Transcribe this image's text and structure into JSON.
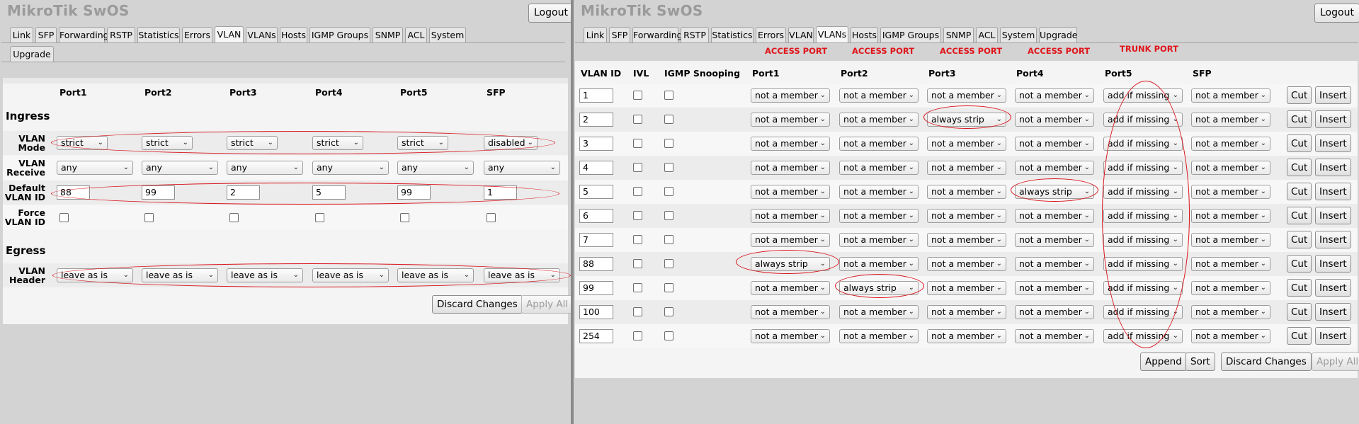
{
  "app": {
    "brand": "MikroTik SwOS",
    "logout_label": "Logout"
  },
  "left": {
    "tabs_row1": [
      "Link",
      "SFP",
      "Forwarding",
      "RSTP",
      "Statistics",
      "Errors",
      "VLAN",
      "VLANs",
      "Hosts",
      "IGMP Groups",
      "SNMP",
      "ACL",
      "System"
    ],
    "tabs_row2": [
      "Upgrade"
    ],
    "active_tab": "VLAN",
    "columns": [
      "Port1",
      "Port2",
      "Port3",
      "Port4",
      "Port5",
      "SFP"
    ],
    "ingress_title": "Ingress",
    "egress_title": "Egress",
    "labels": {
      "vlan_mode": [
        "VLAN",
        "Mode"
      ],
      "vlan_receive": [
        "VLAN",
        "Receive"
      ],
      "default_vlan_id": [
        "Default",
        "VLAN ID"
      ],
      "force_vlan_id": [
        "Force",
        "VLAN ID"
      ],
      "vlan_header": [
        "VLAN",
        "Header"
      ]
    },
    "vlan_mode": [
      "strict",
      "strict",
      "strict",
      "strict",
      "strict",
      "disabled"
    ],
    "vlan_receive": [
      "any",
      "any",
      "any",
      "any",
      "any",
      "any"
    ],
    "default_vlan_id": [
      "88",
      "99",
      "2",
      "5",
      "99",
      "1"
    ],
    "force_vlan_id": [
      false,
      false,
      false,
      false,
      false,
      false
    ],
    "vlan_header": [
      "leave as is",
      "leave as is",
      "leave as is",
      "leave as is",
      "leave as is",
      "leave as is"
    ],
    "discard_label": "Discard Changes",
    "apply_label": "Apply All"
  },
  "right": {
    "tabs_row1": [
      "Link",
      "SFP",
      "Forwarding",
      "RSTP",
      "Statistics",
      "Errors",
      "VLAN",
      "VLANs",
      "Hosts",
      "IGMP Groups",
      "SNMP",
      "ACL",
      "System",
      "Upgrade"
    ],
    "active_tab": "VLANs",
    "annotations": [
      "ACCESS PORT",
      "ACCESS PORT",
      "ACCESS PORT",
      "ACCESS PORT",
      "TRUNK PORT"
    ],
    "columns": [
      "VLAN ID",
      "IVL",
      "IGMP Snooping",
      "Port1",
      "Port2",
      "Port3",
      "Port4",
      "Port5",
      "SFP"
    ],
    "rows": [
      {
        "vlan_id": "1",
        "ports": [
          "not a member",
          "not a member",
          "not a member",
          "not a member",
          "add if missing",
          "not a member"
        ]
      },
      {
        "vlan_id": "2",
        "ports": [
          "not a member",
          "not a member",
          "always strip",
          "not a member",
          "add if missing",
          "not a member"
        ]
      },
      {
        "vlan_id": "3",
        "ports": [
          "not a member",
          "not a member",
          "not a member",
          "not a member",
          "add if missing",
          "not a member"
        ]
      },
      {
        "vlan_id": "4",
        "ports": [
          "not a member",
          "not a member",
          "not a member",
          "not a member",
          "add if missing",
          "not a member"
        ]
      },
      {
        "vlan_id": "5",
        "ports": [
          "not a member",
          "not a member",
          "not a member",
          "always strip",
          "add if missing",
          "not a member"
        ]
      },
      {
        "vlan_id": "6",
        "ports": [
          "not a member",
          "not a member",
          "not a member",
          "not a member",
          "add if missing",
          "not a member"
        ]
      },
      {
        "vlan_id": "7",
        "ports": [
          "not a member",
          "not a member",
          "not a member",
          "not a member",
          "add if missing",
          "not a member"
        ]
      },
      {
        "vlan_id": "88",
        "ports": [
          "always strip",
          "not a member",
          "not a member",
          "not a member",
          "add if missing",
          "not a member"
        ]
      },
      {
        "vlan_id": "99",
        "ports": [
          "not a member",
          "always strip",
          "not a member",
          "not a member",
          "add if missing",
          "not a member"
        ]
      },
      {
        "vlan_id": "100",
        "ports": [
          "not a member",
          "not a member",
          "not a member",
          "not a member",
          "add if missing",
          "not a member"
        ]
      },
      {
        "vlan_id": "254",
        "ports": [
          "not a member",
          "not a member",
          "not a member",
          "not a member",
          "add if missing",
          "not a member"
        ]
      }
    ],
    "cut_label": "Cut",
    "insert_label": "Insert",
    "append_label": "Append",
    "sort_label": "Sort",
    "discard_label": "Discard Changes",
    "apply_label": "Apply All"
  },
  "colors": {
    "annotation": "#e0151b",
    "panel": "#f4f4f4",
    "background": "#d3d3d3",
    "brand": "#9a9a9a"
  }
}
